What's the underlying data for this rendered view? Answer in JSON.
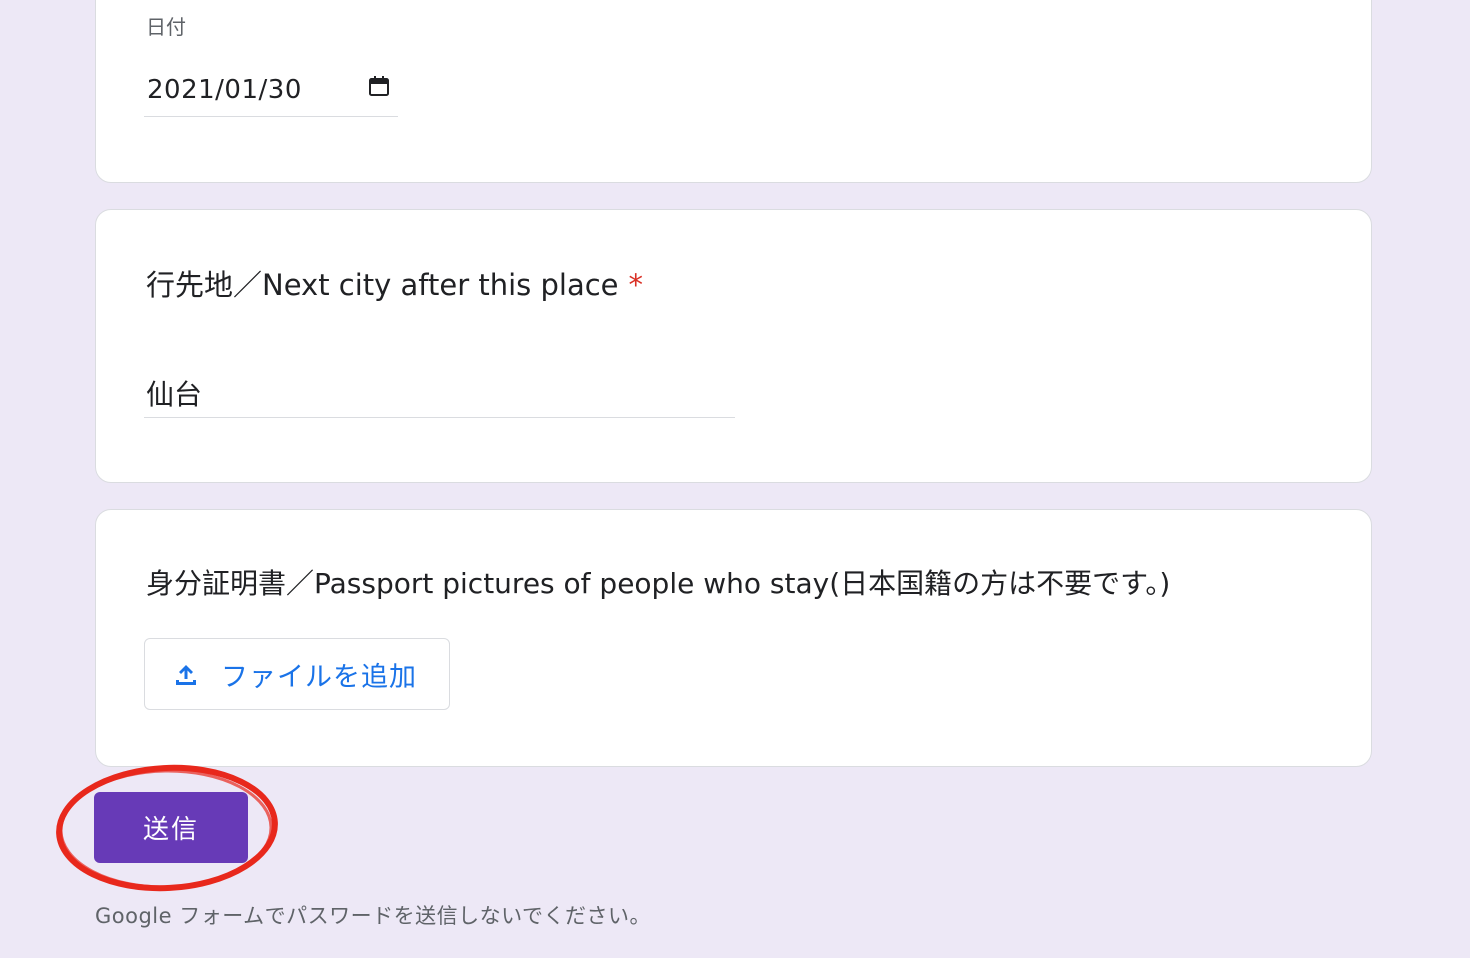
{
  "date_question": {
    "label": "日付",
    "value": "2021/01/30",
    "picker_icon": "calendar-icon"
  },
  "city_question": {
    "title": "行先地／Next city after this place",
    "required_mark": "*",
    "answer": "仙台"
  },
  "passport_question": {
    "title": "身分証明書／Passport pictures of people who stay(日本国籍の方は不要です。)",
    "upload_label": "ファイルを追加",
    "upload_icon": "upload-icon"
  },
  "submit": {
    "label": "送信"
  },
  "footer": {
    "note": "Google フォームでパスワードを送信しないでください。"
  },
  "colors": {
    "page_background": "#ede8f6",
    "accent": "#673ab7",
    "link_blue": "#1a73e8",
    "required_red": "#d93025",
    "annotation_red": "#e8281c"
  }
}
